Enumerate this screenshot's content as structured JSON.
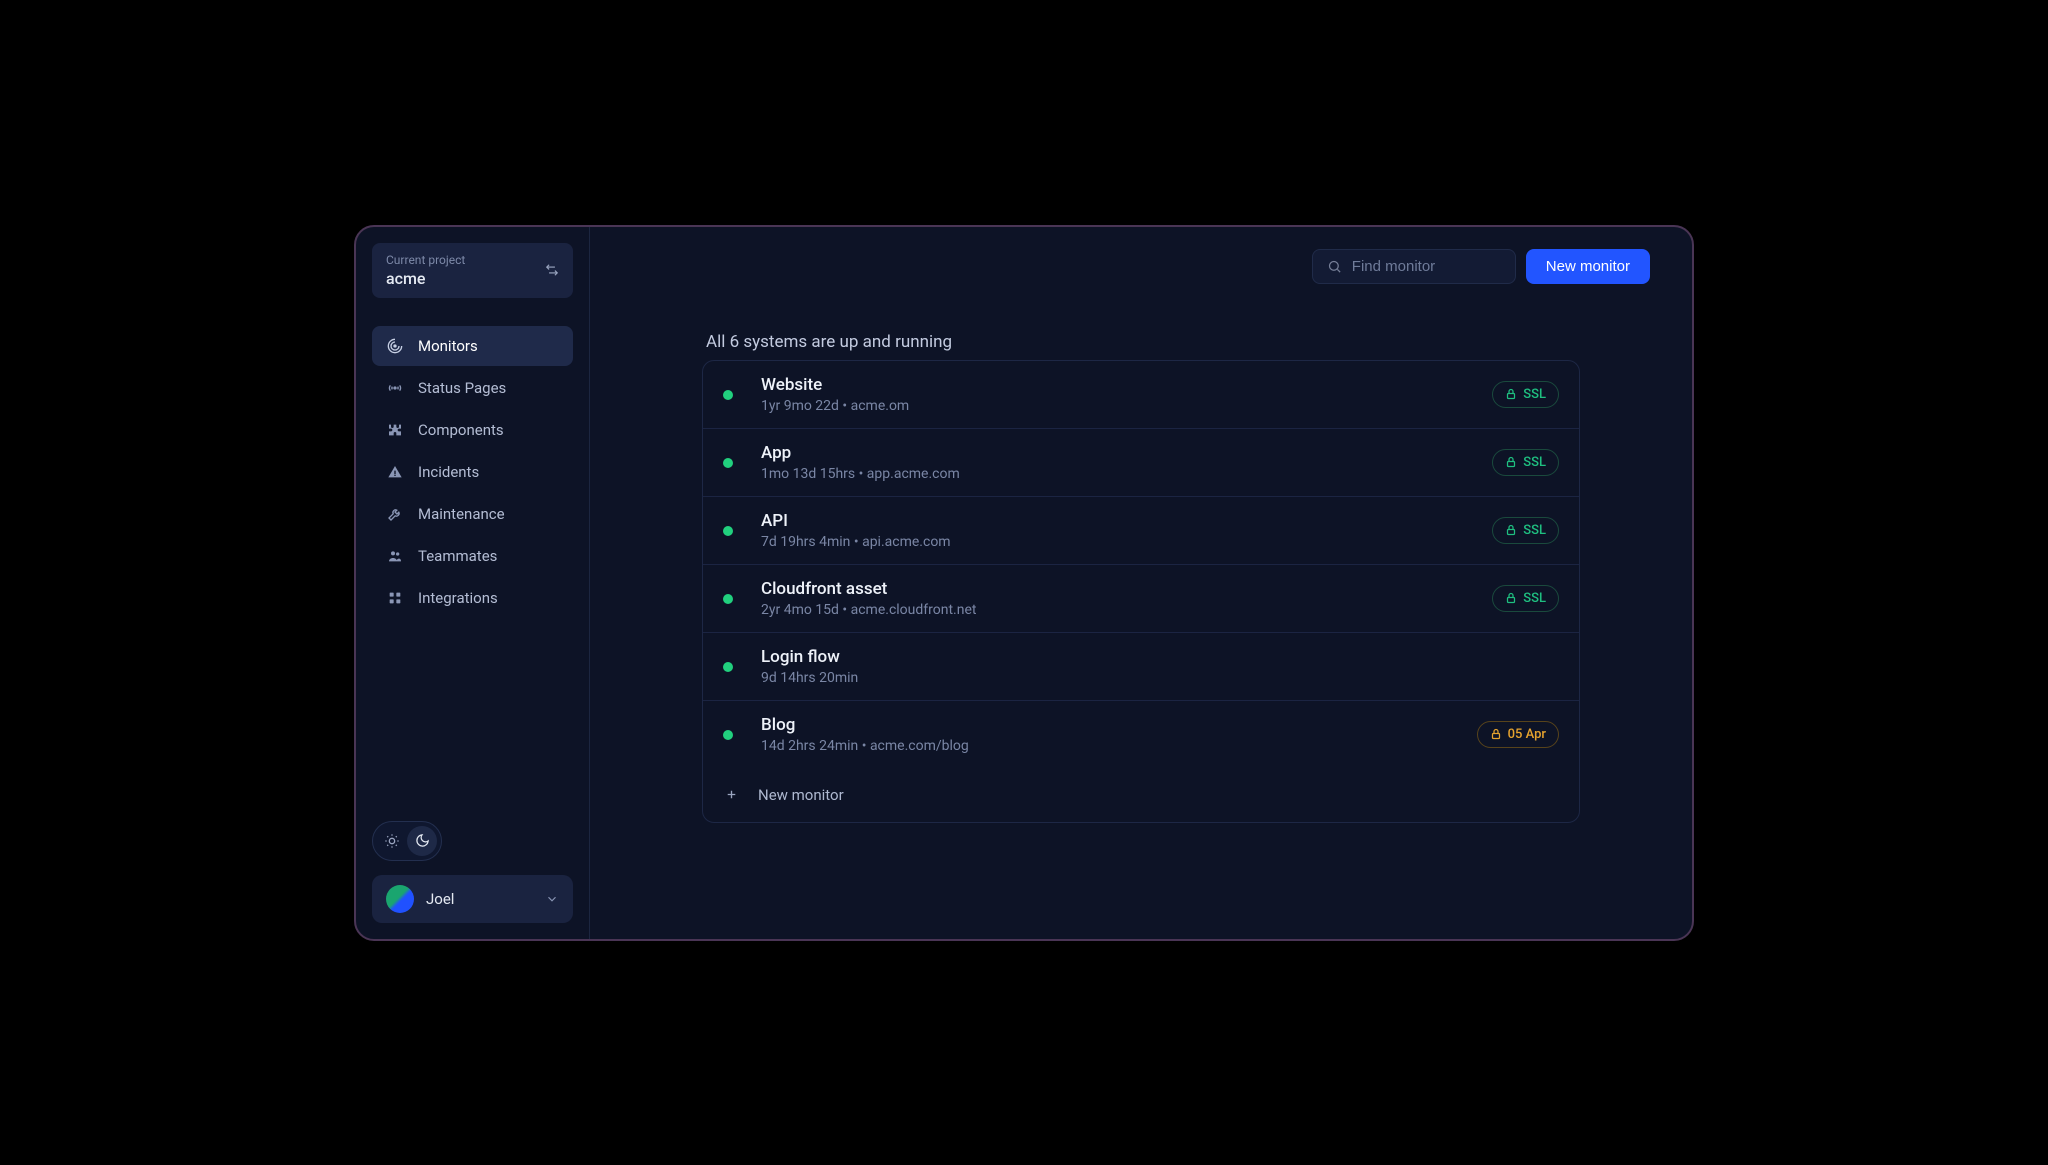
{
  "project": {
    "label": "Current project",
    "name": "acme"
  },
  "nav": [
    {
      "label": "Monitors",
      "icon": "radar",
      "active": true
    },
    {
      "label": "Status Pages",
      "icon": "broadcast",
      "active": false
    },
    {
      "label": "Components",
      "icon": "puzzle",
      "active": false
    },
    {
      "label": "Incidents",
      "icon": "warning",
      "active": false
    },
    {
      "label": "Maintenance",
      "icon": "wrench",
      "active": false
    },
    {
      "label": "Teammates",
      "icon": "users",
      "active": false
    },
    {
      "label": "Integrations",
      "icon": "grid",
      "active": false
    }
  ],
  "user": {
    "name": "Joel"
  },
  "toolbar": {
    "search_placeholder": "Find monitor",
    "new_monitor_label": "New monitor"
  },
  "status_summary": "All 6 systems are up and running",
  "monitors": [
    {
      "name": "Website",
      "uptime": "1yr 9mo 22d",
      "host": "acme.om",
      "status": "up",
      "badge": {
        "type": "ssl",
        "text": "SSL"
      }
    },
    {
      "name": "App",
      "uptime": "1mo 13d 15hrs",
      "host": "app.acme.com",
      "status": "up",
      "badge": {
        "type": "ssl",
        "text": "SSL"
      }
    },
    {
      "name": "API",
      "uptime": "7d 19hrs 4min",
      "host": "api.acme.com",
      "status": "up",
      "badge": {
        "type": "ssl",
        "text": "SSL"
      }
    },
    {
      "name": "Cloudfront asset",
      "uptime": "2yr 4mo 15d",
      "host": "acme.cloudfront.net",
      "status": "up",
      "badge": {
        "type": "ssl",
        "text": "SSL"
      }
    },
    {
      "name": "Login flow",
      "uptime": "9d 14hrs 20min",
      "host": "",
      "status": "up",
      "badge": null
    },
    {
      "name": "Blog",
      "uptime": "14d 2hrs 24min",
      "host": "acme.com/blog",
      "status": "up",
      "badge": {
        "type": "warn",
        "text": "05 Apr"
      }
    }
  ],
  "add_row_label": "New monitor"
}
